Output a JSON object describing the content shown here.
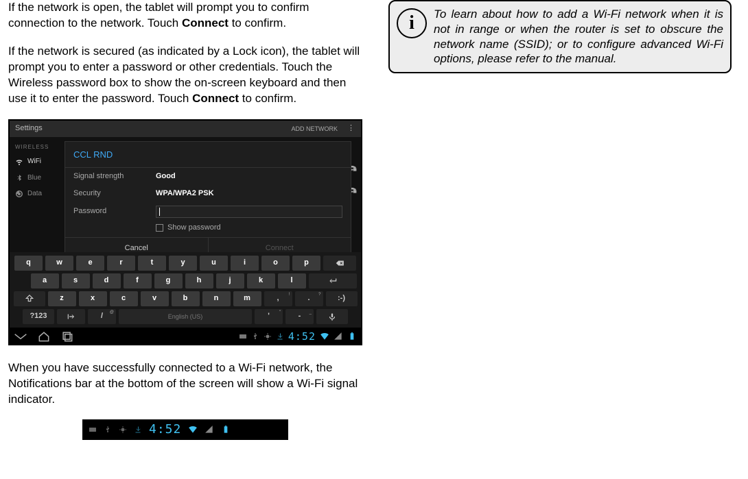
{
  "para1a": "If the network is open, the tablet will prompt you to confirm connection to the network. Touch ",
  "para1b": "Connect",
  "para1c": " to confirm.",
  "para2a": "If the network is secured (as indicated by a Lock icon), the tablet will prompt you to enter a password or other credentials.  Touch the Wireless password box to show the on-screen keyboard and then use it to enter the password. Touch ",
  "para2b": "Connect",
  "para2c": " to confirm.",
  "para3": "When you have successfully connected to a Wi-Fi network, the Notifications bar at the bottom of the screen will show a Wi-Fi signal indicator.",
  "tip": "To learn about how to add a Wi-Fi network when it is not in range or when the router is set to obscure the network name (SSID); or to configure advanced Wi-Fi options, please refer to the manual.",
  "tip_icon": "i",
  "shot1": {
    "topbar": {
      "left": "Settings",
      "addnet": "ADD NETWORK",
      "dots": "⋮"
    },
    "sidebar": {
      "heading": "WIRELESS",
      "wifi": "WiFi",
      "bt": "Blue",
      "data": "Data"
    },
    "dialog": {
      "title": "CCL RND",
      "signal_lbl": "Signal strength",
      "signal_val": "Good",
      "sec_lbl": "Security",
      "sec_val": "WPA/WPA2 PSK",
      "pwd_lbl": "Password",
      "showpwd": "Show password",
      "cancel": "Cancel",
      "connect": "Connect"
    },
    "kbd": {
      "r1": [
        "q",
        "w",
        "e",
        "r",
        "t",
        "y",
        "u",
        "i",
        "o",
        "p"
      ],
      "r2": [
        "a",
        "s",
        "d",
        "f",
        "g",
        "h",
        "j",
        "k",
        "l"
      ],
      "r3": [
        "z",
        "x",
        "c",
        "v",
        "b",
        "n",
        "m",
        ",",
        "."
      ],
      "r4": {
        "mode": "?123",
        "slash": "/",
        "space": "English (US)",
        "apos": "'",
        "dash": "-"
      },
      "r3_smile": ":-)"
    },
    "clock": "4:52"
  },
  "shot2": {
    "clock": "4:52"
  }
}
